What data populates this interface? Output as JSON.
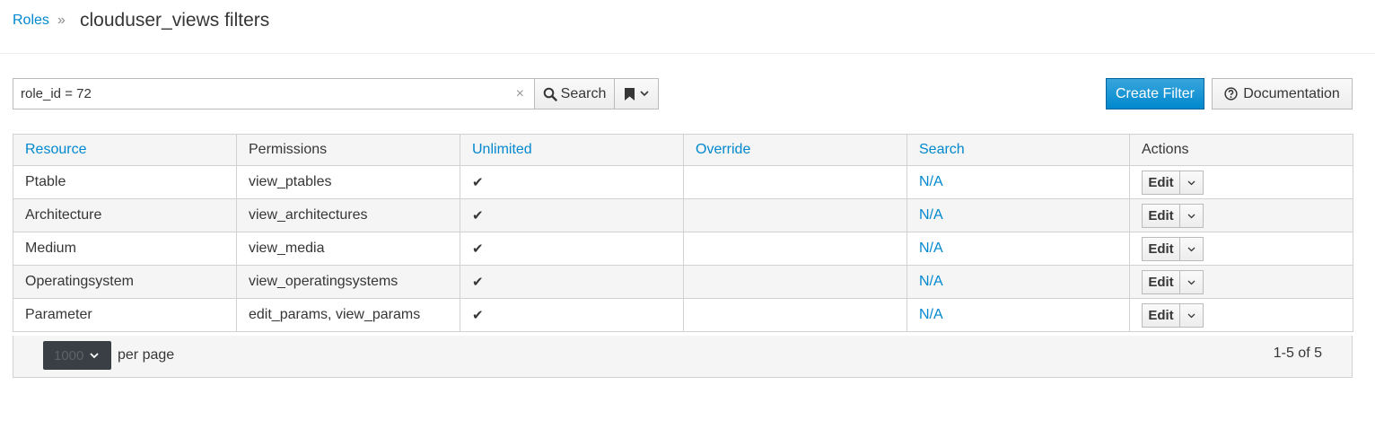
{
  "breadcrumb": {
    "root": "Roles",
    "separator": "»",
    "title": "clouduser_views filters"
  },
  "search": {
    "value": "role_id = 72",
    "clear_glyph": "×",
    "button_label": "Search"
  },
  "actions": {
    "create_label": "Create Filter",
    "doc_label": "Documentation"
  },
  "table": {
    "headers": {
      "resource": "Resource",
      "permissions": "Permissions",
      "unlimited": "Unlimited",
      "override": "Override",
      "search": "Search",
      "actions": "Actions"
    },
    "rows": [
      {
        "resource": "Ptable",
        "permissions": "view_ptables",
        "unlimited": "✔",
        "override": "",
        "search": "N/A",
        "edit": "Edit"
      },
      {
        "resource": "Architecture",
        "permissions": "view_architectures",
        "unlimited": "✔",
        "override": "",
        "search": "N/A",
        "edit": "Edit"
      },
      {
        "resource": "Medium",
        "permissions": "view_media",
        "unlimited": "✔",
        "override": "",
        "search": "N/A",
        "edit": "Edit"
      },
      {
        "resource": "Operatingsystem",
        "permissions": "view_operatingsystems",
        "unlimited": "✔",
        "override": "",
        "search": "N/A",
        "edit": "Edit"
      },
      {
        "resource": "Parameter",
        "permissions": "edit_params, view_params",
        "unlimited": "✔",
        "override": "",
        "search": "N/A",
        "edit": "Edit"
      }
    ]
  },
  "pagination": {
    "per_page_value": "1000",
    "per_page_label": "per page",
    "range": "1-5 of 5"
  },
  "colors": {
    "link": "#0088ce",
    "primary": "#0088ce",
    "select_bg": "#393f44"
  },
  "icons": {
    "search": "magnifier-icon",
    "bookmark": "bookmark-icon",
    "doc": "question-circle-icon",
    "caret": "chevron-down-icon",
    "check": "checkmark-icon"
  }
}
